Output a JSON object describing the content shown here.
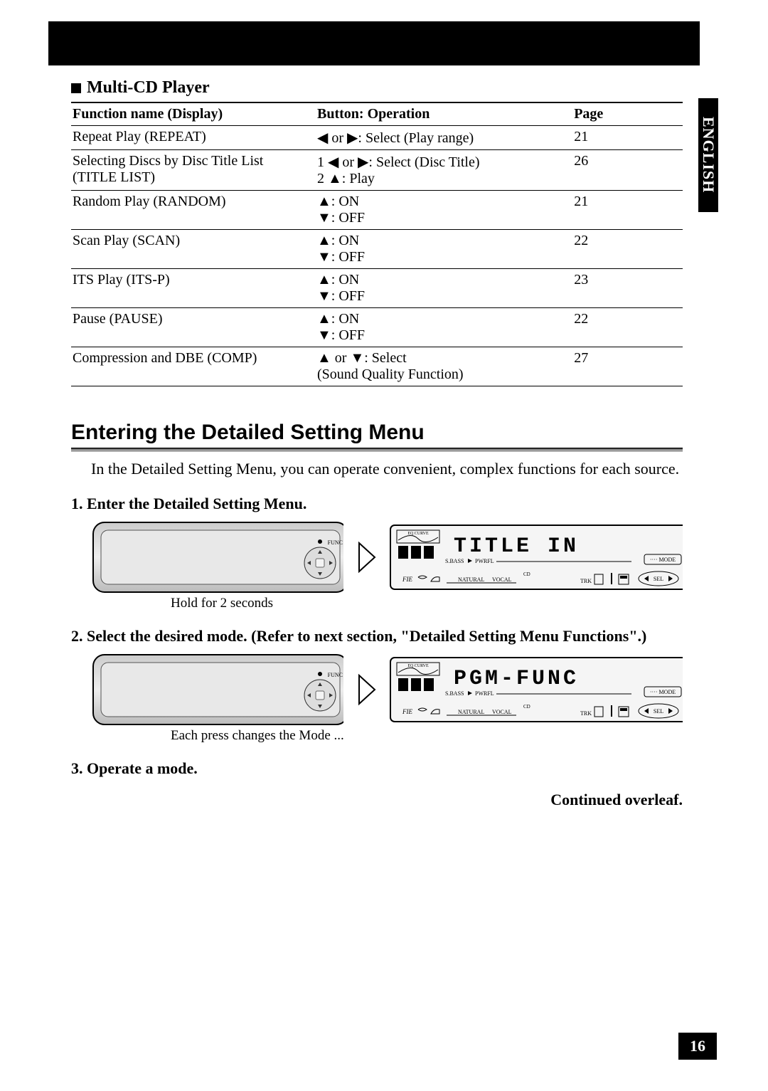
{
  "language_tab": "ENGLISH",
  "page_number": "16",
  "section_title": "Multi-CD Player",
  "table": {
    "headers": {
      "func": "Function name (Display)",
      "btn": "Button: Operation",
      "page": "Page"
    },
    "rows": [
      {
        "func": "Repeat Play (REPEAT)",
        "btn": "◀ or ▶: Select (Play range)",
        "page": "21"
      },
      {
        "func": "Selecting Discs by Disc Title List\n(TITLE LIST)",
        "btn": "1 ◀ or ▶: Select (Disc Title)\n2 ▲: Play",
        "page": "26"
      },
      {
        "func": "Random Play (RANDOM)",
        "btn": "▲: ON\n▼: OFF",
        "page": "21"
      },
      {
        "func": "Scan Play (SCAN)",
        "btn": "▲: ON\n▼: OFF",
        "page": "22"
      },
      {
        "func": "ITS Play (ITS-P)",
        "btn": "▲: ON\n▼: OFF",
        "page": "23"
      },
      {
        "func": "Pause (PAUSE)",
        "btn": "▲: ON\n▼: OFF",
        "page": "22"
      },
      {
        "func": "Compression and DBE (COMP)",
        "btn": "▲ or ▼: Select\n(Sound Quality Function)",
        "page": "27"
      }
    ]
  },
  "section2": {
    "heading": "Entering the Detailed Setting Menu",
    "intro": "In the Detailed Setting Menu, you can operate convenient, complex functions for each source.",
    "steps": {
      "s1": {
        "num": "1.",
        "text": "Enter the Detailed Setting Menu.",
        "caption": "Hold for 2 seconds",
        "lcd": "TITLE  IN"
      },
      "s2": {
        "num": "2.",
        "text": "Select the desired mode. (Refer to next section, \"Detailed Setting Menu Functions\".)",
        "caption": "Each press changes the Mode ...",
        "lcd": "PGM-FUNC"
      },
      "s3": {
        "num": "3.",
        "text": "Operate a mode."
      }
    },
    "continued": "Continued overleaf."
  },
  "lcd_labels": {
    "eq_curve": "EQ CURVE",
    "sbass": "S.BASS",
    "pwrfl": "PWRFL",
    "mode": "MODE",
    "fie": "FIE",
    "natural": "NATURAL",
    "vocal": "VOCAL",
    "cd": "CD",
    "trk": "TRK",
    "sel": "SEL"
  }
}
